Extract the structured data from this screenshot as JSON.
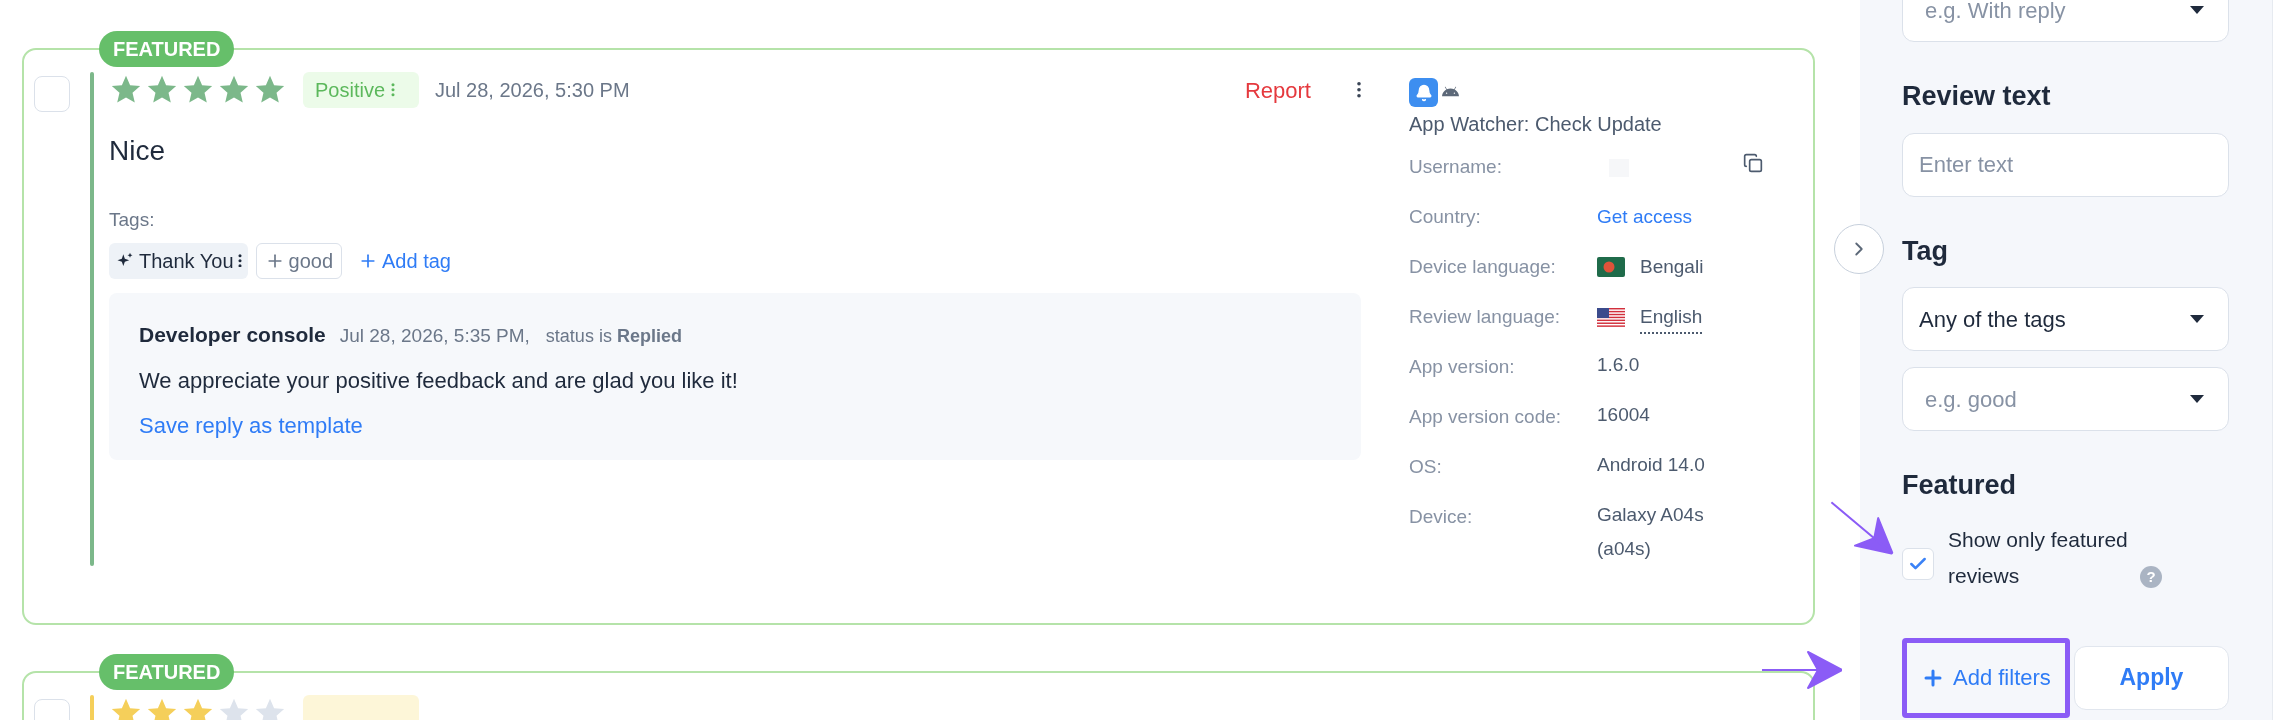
{
  "cards": [
    {
      "featured_badge": "FEATURED",
      "checked": false,
      "stars": 5,
      "sentiment": {
        "kind": "positive",
        "label": "Positive"
      },
      "date": "Jul 28, 2026, 5:30 PM",
      "report": "Report",
      "text": "Nice",
      "tags_label": "Tags:",
      "tags": [
        {
          "kind": "ai",
          "label": "Thank You"
        },
        {
          "kind": "suggested",
          "label": "good"
        }
      ],
      "add_tag": "Add tag",
      "reply": {
        "author": "Developer console",
        "date": "Jul 28, 2026, 5:35 PM,",
        "status": "status is **Replied**",
        "text": "We appreciate your positive feedback and are glad you like it!",
        "save_template": "Save reply as template"
      },
      "app": {
        "name": "App Watcher: Check Update"
      },
      "meta": [
        {
          "kind": "redacted",
          "label": "Username:"
        },
        {
          "kind": "link",
          "label": "Country:",
          "value": "Get access"
        },
        {
          "kind": "flag",
          "label": "Device language:",
          "flag": {
            "kind": "bd"
          },
          "value": "Bengali",
          "underlined": false
        },
        {
          "kind": "flag",
          "label": "Review language:",
          "flag": {
            "kind": "us"
          },
          "value": "English",
          "underlined": true
        },
        {
          "kind": "text",
          "label": "App version:",
          "value": "1.6.0"
        },
        {
          "kind": "text",
          "label": "App version code:",
          "value": "16004"
        },
        {
          "kind": "text",
          "label": "OS:",
          "value": "Android 14.0"
        },
        {
          "kind": "text",
          "label": "Device:",
          "value": "Galaxy A04s (a04s)"
        }
      ]
    },
    {
      "featured_badge": "FEATURED",
      "checked": false,
      "stars": 3,
      "sentiment": {
        "kind": "neutral"
      }
    }
  ],
  "sidebar": {
    "sections": [
      {
        "kind": "select",
        "placeholder": "e.g. With reply"
      },
      {
        "kind": "heading",
        "text": "Review text"
      },
      {
        "kind": "input",
        "placeholder": "Enter text"
      },
      {
        "kind": "heading",
        "text": "Tag"
      },
      {
        "kind": "select",
        "value": "Any of the tags"
      },
      {
        "kind": "select",
        "placeholder": "e.g. good"
      },
      {
        "kind": "heading",
        "text": "Featured"
      },
      {
        "kind": "checkbox",
        "label": "Show only featured reviews",
        "checked": true,
        "help": "?",
        "highlighted": true
      }
    ],
    "add_filters": {
      "label": "Add filters",
      "highlighted": true
    },
    "apply": "Apply"
  }
}
